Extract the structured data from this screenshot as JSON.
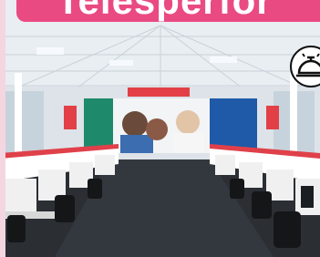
{
  "banner": {
    "text": "Telesperfor"
  },
  "scene": {
    "icon": "service-bell-icon",
    "colors": {
      "banner_pink": "#ea4a82",
      "desk_red": "#e0404a",
      "carpet": "#2b2f34",
      "ceiling": "#e9eef2",
      "mural_blue": "#1e5aa8",
      "mural_green": "#1f8a6b",
      "mural_red": "#e24046"
    }
  }
}
